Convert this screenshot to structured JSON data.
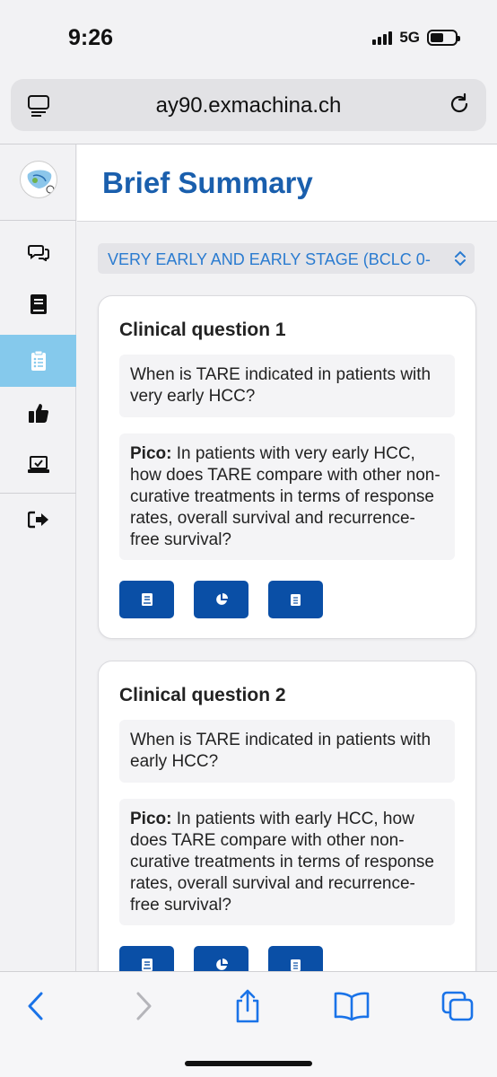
{
  "status": {
    "time": "9:26",
    "network": "5G"
  },
  "browser": {
    "url": "ay90.exmachina.ch"
  },
  "sidebar": {
    "items": [
      {
        "name": "chat",
        "icon": "chat-bubbles-icon",
        "active": false
      },
      {
        "name": "book",
        "icon": "book-icon",
        "active": false
      },
      {
        "name": "summary",
        "icon": "clipboard-list-icon",
        "active": true
      },
      {
        "name": "recommendations",
        "icon": "thumbs-up-icon",
        "active": false
      },
      {
        "name": "vote",
        "icon": "laptop-check-icon",
        "active": false
      }
    ],
    "logout_icon": "sign-out-icon"
  },
  "page": {
    "title": "Brief Summary"
  },
  "stage_select": {
    "value": "VERY EARLY AND EARLY STAGE (BCLC 0-"
  },
  "questions": [
    {
      "title": "Clinical question 1",
      "question": "When is TARE indicated in patients with very early HCC?",
      "pico_label": "Pico:",
      "pico": "In patients with very early HCC, how does TARE compare with other non-curative treatments in terms of response rates, overall survival and recurrence-free survival?"
    },
    {
      "title": "Clinical question 2",
      "question": "When is TARE indicated in patients with early HCC?",
      "pico_label": "Pico:",
      "pico": "In patients with early HCC, how does TARE compare with other non-curative treatments in terms of response rates, overall survival and recurrence-free survival?"
    }
  ],
  "colors": {
    "accent": "#0a4fa6",
    "title": "#1a5fad",
    "active_nav": "#85c9ec",
    "link": "#2a7bd0"
  }
}
